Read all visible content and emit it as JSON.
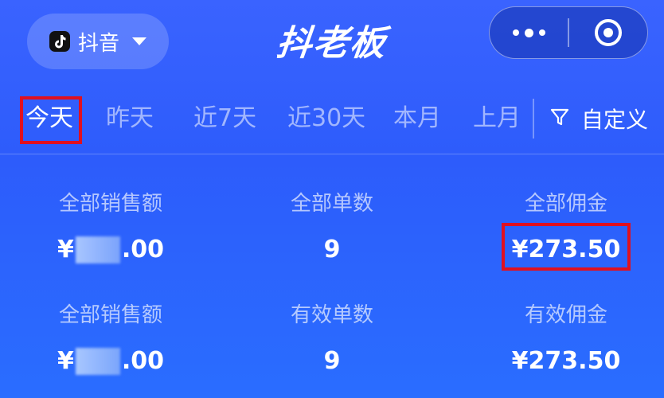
{
  "header": {
    "platform_label": "抖音",
    "app_title": "抖老板",
    "platform_icon": "tiktok-icon",
    "more_icon": "more-dots-icon",
    "close_icon": "target-circle-icon"
  },
  "tabs": [
    {
      "label": "今天",
      "active": true
    },
    {
      "label": "昨天",
      "active": false
    },
    {
      "label": "近7天",
      "active": false
    },
    {
      "label": "近30天",
      "active": false
    },
    {
      "label": "本月",
      "active": false
    },
    {
      "label": "上月",
      "active": false
    }
  ],
  "custom_filter": {
    "label": "自定义",
    "icon": "filter-icon"
  },
  "stats": {
    "row1": [
      {
        "label": "全部销售额",
        "currency": "¥",
        "value": ".00",
        "redacted": true
      },
      {
        "label": "全部单数",
        "value": "9"
      },
      {
        "label": "全部佣金",
        "value": "¥273.50"
      }
    ],
    "row2": [
      {
        "label": "全部销售额",
        "currency": "¥",
        "value": ".00",
        "redacted": true
      },
      {
        "label": "有效单数",
        "value": "9"
      },
      {
        "label": "有效佣金",
        "value": "¥273.50"
      }
    ]
  },
  "colors": {
    "background": "#2d5cfb",
    "highlight": "#e01020"
  }
}
